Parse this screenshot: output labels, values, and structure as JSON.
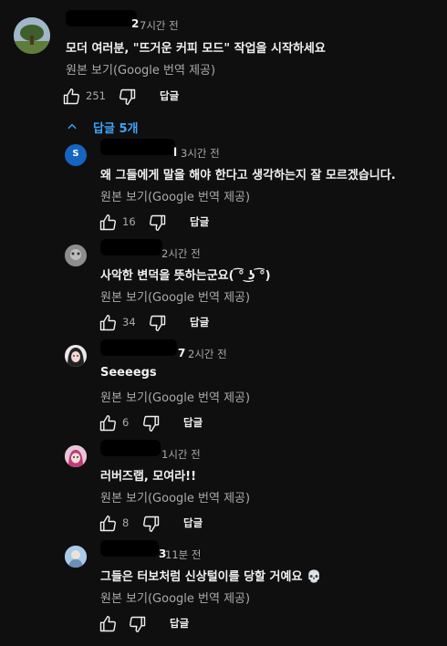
{
  "top": {
    "author_suffix": "2",
    "time": "7시간 전",
    "text": "모더 여러분, \"뜨거운 커피 모드\" 작업을 시작하세요",
    "translation_note": "원본 보기(Google 번역 제공)",
    "likes": "251",
    "reply_label": "답글"
  },
  "replies_toggle": {
    "label": "답글 5개"
  },
  "replies": [
    {
      "author_suffix": "l",
      "time": "3시간 전",
      "text": "왜 그들에게 말을 해야 한다고 생각하는지 잘 모르겠습니다.",
      "translation_note": "원본 보기(Google 번역 제공)",
      "likes": "16",
      "reply_label": "답글",
      "avatar_letter": "S"
    },
    {
      "author_suffix": "",
      "time": "2시간 전",
      "text": "사악한 변덕을 뜻하는군요( ͡° ͜ʖ ͡°)",
      "translation_note": "원본 보기(Google 번역 제공)",
      "likes": "34",
      "reply_label": "답글"
    },
    {
      "author_suffix": "7",
      "time": "2시간 전",
      "text": "Seeeegs",
      "translation_note": "원본 보기(Google 번역 제공)",
      "likes": "6",
      "reply_label": "답글"
    },
    {
      "author_suffix": "",
      "time": "1시간 전",
      "text": "러버즈랩, 모여라!!",
      "translation_note": "원본 보기(Google 번역 제공)",
      "likes": "8",
      "reply_label": "답글"
    },
    {
      "author_suffix": "3",
      "time": "11분 전",
      "text": "그들은 터보처럼 신상털이를 당할 거예요 💀",
      "translation_note": "원본 보기(Google 번역 제공)",
      "likes": "",
      "reply_label": "답글"
    }
  ],
  "colors": {
    "background": "#0f0f0f",
    "link": "#3ea6ff",
    "secondary": "#aaaaaa"
  }
}
